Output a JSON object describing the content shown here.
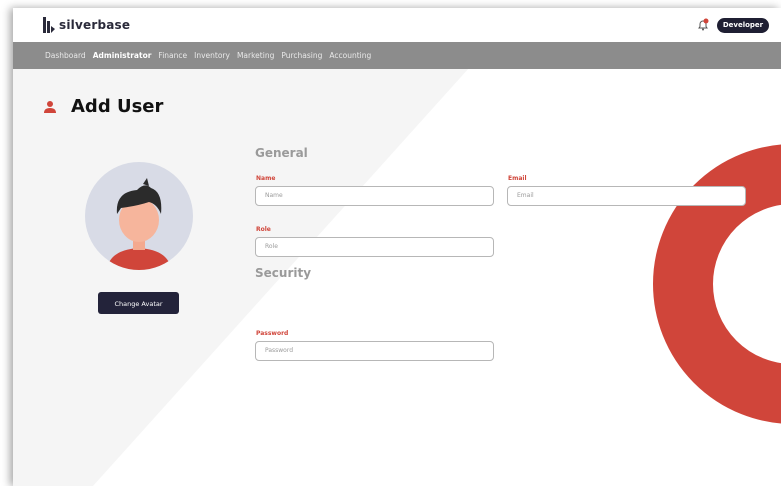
{
  "brand": {
    "name": "silverbase"
  },
  "topbar": {
    "user_button": "Developer"
  },
  "nav": {
    "items": [
      "Dashboard",
      "Administrator",
      "Finance",
      "Inventory",
      "Marketing",
      "Purchasing",
      "Accounting"
    ],
    "active_index": 1
  },
  "page": {
    "title": "Add User"
  },
  "avatar": {
    "button_label": "Change Avatar"
  },
  "general": {
    "heading": "General",
    "name": {
      "label": "Name",
      "placeholder": "Name"
    },
    "email": {
      "label": "Email",
      "placeholder": "Email"
    },
    "role": {
      "label": "Role",
      "placeholder": "Role"
    }
  },
  "security": {
    "heading": "Security",
    "password": {
      "label": "Password",
      "placeholder": "Password"
    }
  },
  "colors": {
    "accent": "#d0453a",
    "dark": "#1f1f33",
    "nav": "#8c8c8c"
  }
}
